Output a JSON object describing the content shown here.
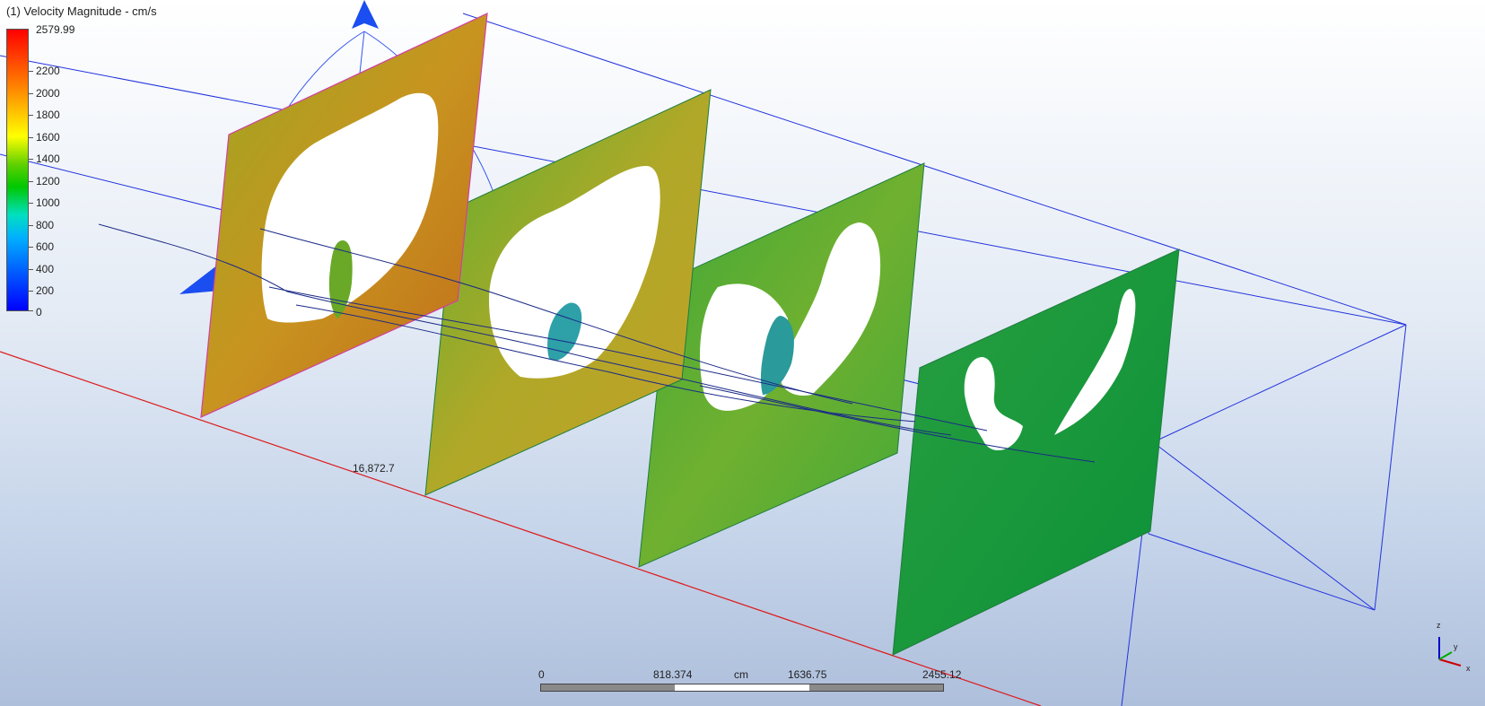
{
  "legend": {
    "title": "(1) Velocity Magnitude - cm/s",
    "max_label": "2579.99",
    "labels": [
      "2200",
      "2000",
      "1800",
      "1600",
      "1400",
      "1200",
      "1000",
      "800",
      "600",
      "400",
      "200",
      "0"
    ],
    "colors": {
      "high": "#ff0000",
      "mid": "#ffff00",
      "low": "#0000ff"
    }
  },
  "scale": {
    "labels": [
      "0",
      "818.374",
      "cm",
      "1636.75",
      "2455.12"
    ]
  },
  "dimension_label": "16,872.7",
  "triad": {
    "z": "z",
    "y": "y",
    "x": "x"
  },
  "icons": [
    "rotate-arrow-up-icon",
    "rotate-arrow-left-icon",
    "rotate-arrow-right-icon",
    "axis-triad-icon"
  ],
  "planes": [
    {
      "name": "cut-plane-1",
      "dominant_color": "#c8a020"
    },
    {
      "name": "cut-plane-2",
      "dominant_color": "#a8b028"
    },
    {
      "name": "cut-plane-3",
      "dominant_color": "#58a830"
    },
    {
      "name": "cut-plane-4",
      "dominant_color": "#1e9a3a"
    }
  ]
}
